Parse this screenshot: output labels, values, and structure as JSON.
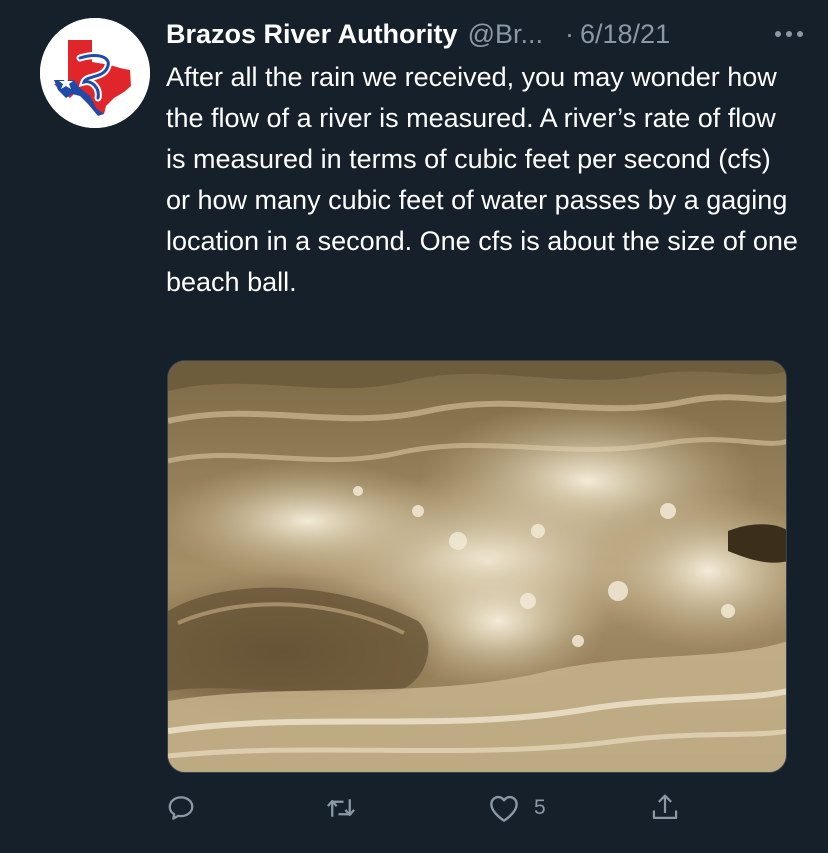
{
  "tweet": {
    "display_name": "Brazos River Authority",
    "handle": "@Br...",
    "separator": "·",
    "date": "6/18/21",
    "more_icon": "more-horizontal-icon",
    "text": "After all the rain we received, you may wonder how the flow of a river is measured. A river’s rate of flow is measured in terms of cubic feet per second (cfs) or how many cubic feet of water passes by a gaging location in a second. One cfs is about the size of one beach ball.",
    "avatar": {
      "description_icon": "brazos-river-authority-logo",
      "colors": {
        "red": "#e0262b",
        "blue": "#1f4aa8",
        "white": "#ffffff"
      }
    },
    "media": {
      "icon": "river-rapids-photo",
      "colors": {
        "foam": "#efe6cf",
        "water": "#9a8560",
        "dark": "#5a4a30"
      }
    },
    "actions": {
      "reply_icon": "reply-icon",
      "retweet_icon": "retweet-icon",
      "like_icon": "heart-icon",
      "like_count": "5",
      "share_icon": "share-icon"
    }
  },
  "theme": {
    "background": "#15202b",
    "text": "#ffffff",
    "muted": "#8b98a5"
  }
}
